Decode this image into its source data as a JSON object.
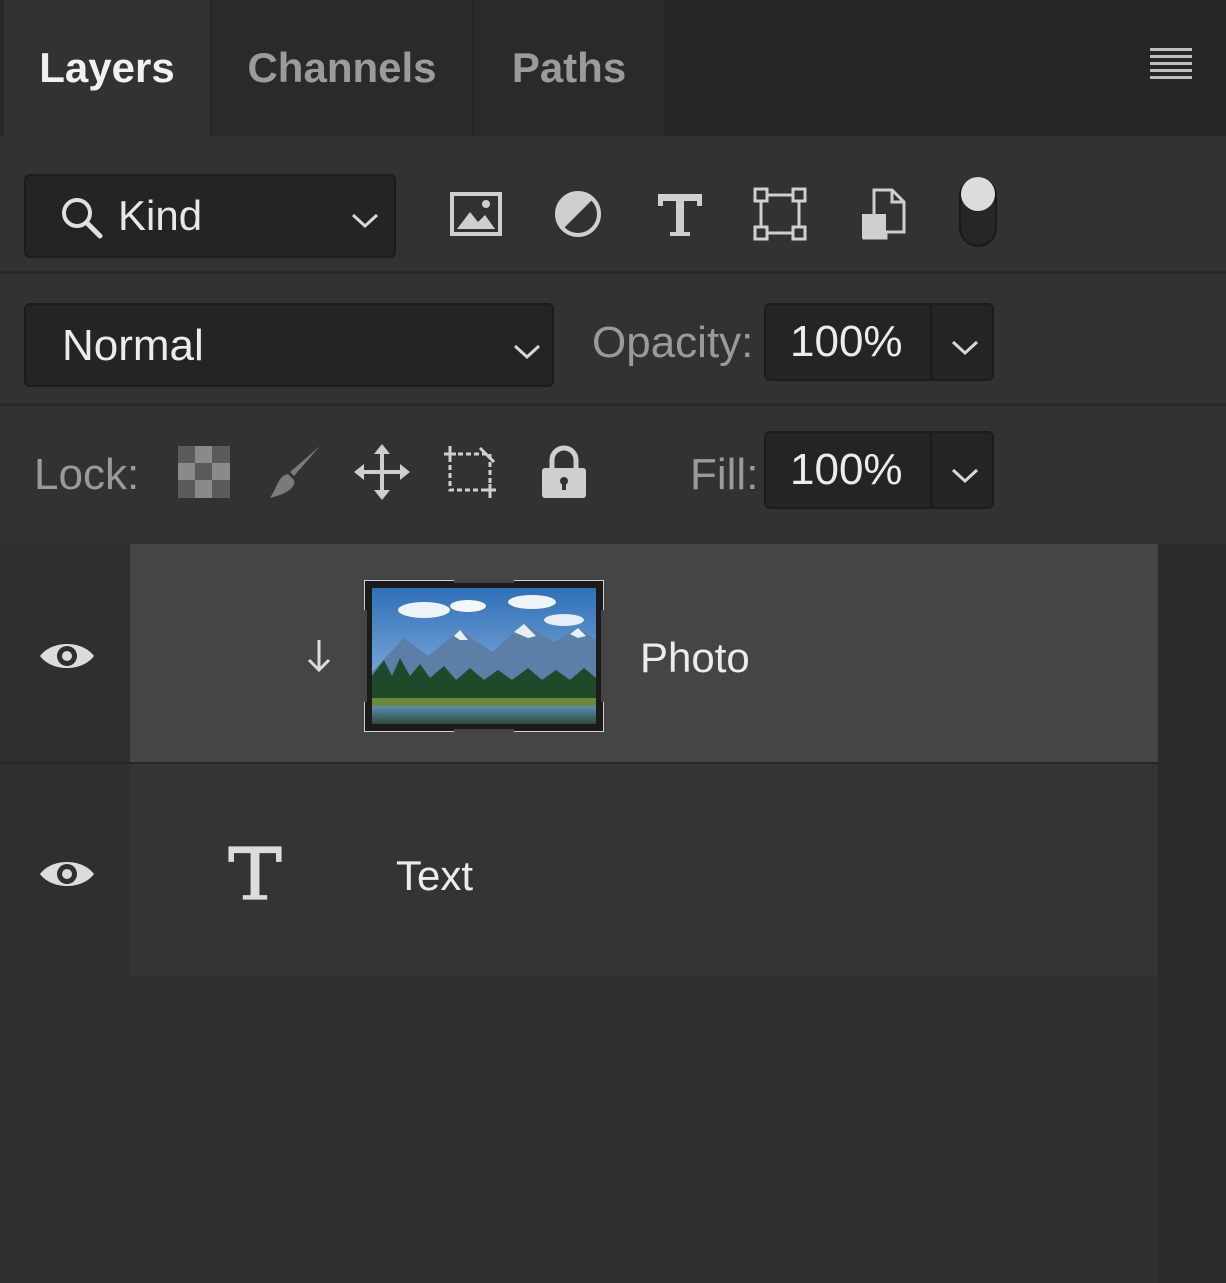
{
  "tabs": [
    {
      "label": "Layers",
      "active": true
    },
    {
      "label": "Channels",
      "active": false
    },
    {
      "label": "Paths",
      "active": false
    }
  ],
  "filter": {
    "kind_label": "Kind",
    "icons": [
      "image-filter-icon",
      "adjustment-filter-icon",
      "type-filter-icon",
      "shape-filter-icon",
      "smart-object-filter-icon",
      "filter-toggle-switch"
    ]
  },
  "blend": {
    "mode": "Normal",
    "opacity_label": "Opacity:",
    "opacity_value": "100%"
  },
  "lock": {
    "label": "Lock:",
    "icons": [
      "lock-transparent-pixels-icon",
      "lock-image-pixels-icon",
      "lock-position-icon",
      "lock-artboard-icon",
      "lock-all-icon"
    ],
    "fill_label": "Fill:",
    "fill_value": "100%"
  },
  "layers": [
    {
      "name": "Photo",
      "type": "image",
      "visible": true,
      "selected": true,
      "clipped": true
    },
    {
      "name": "Text",
      "type": "text",
      "visible": true,
      "selected": false,
      "clipped": false
    }
  ],
  "colors": {
    "panel_bg": "#323232",
    "tabbar_bg": "#262626",
    "selected_layer": "#454545",
    "text_primary": "#ececec",
    "text_secondary": "#9a9a9a"
  }
}
